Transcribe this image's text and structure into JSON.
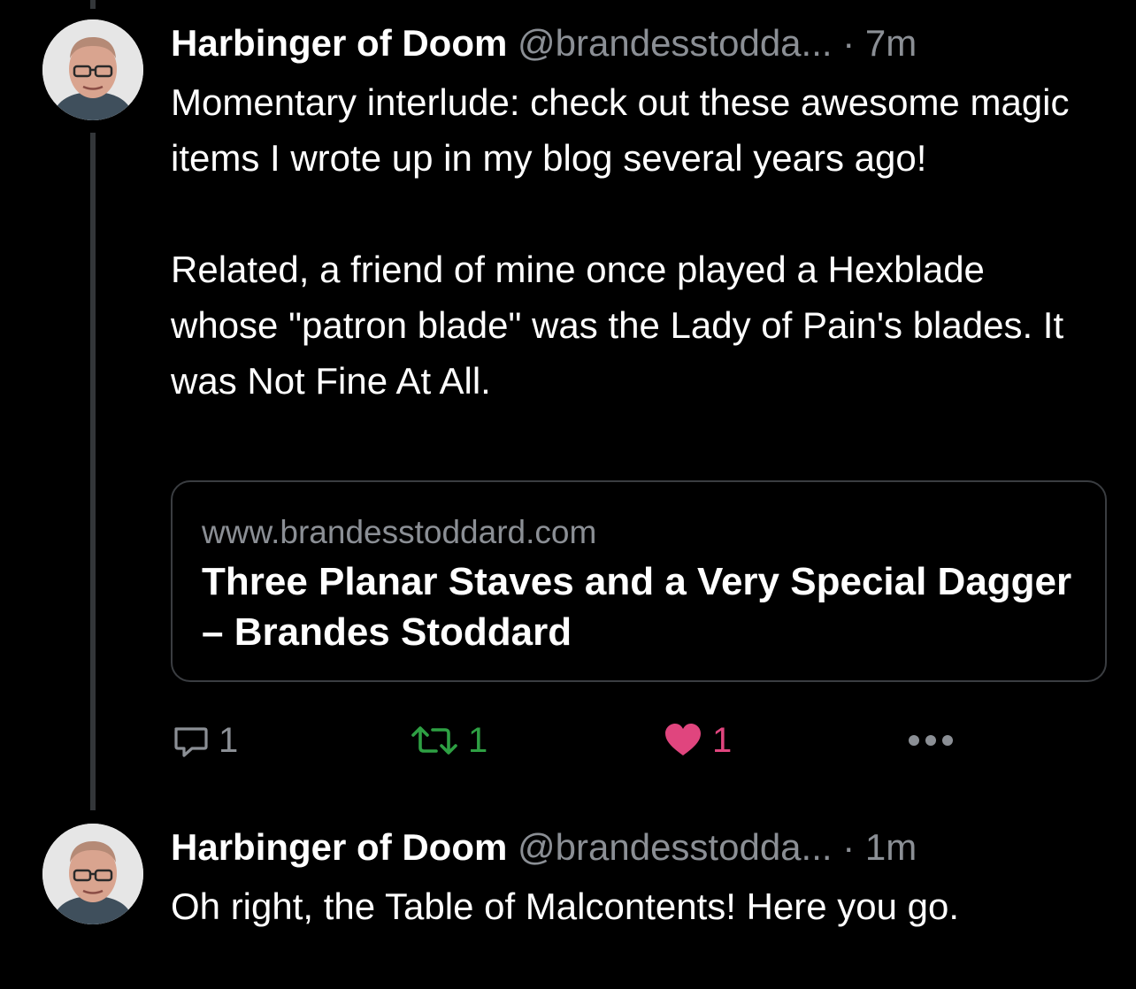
{
  "tweets": [
    {
      "display_name": "Harbinger of Doom",
      "handle": "@brandesstodda...",
      "separator": "·",
      "time": "7m",
      "text_paragraphs": [
        "Momentary interlude: check out these awesome magic items I wrote up in my blog several years ago!",
        "Related, a friend of mine once played a Hexblade whose \"patron blade\" was the Lady of Pain's blades. It was Not Fine At All."
      ],
      "link_card": {
        "domain": "www.brandesstoddard.com",
        "title": "Three Planar Staves and a Very Special Dagger – Brandes Stoddard"
      },
      "actions": {
        "reply_count": "1",
        "retweet_count": "1",
        "like_count": "1",
        "reply_icon": "reply-icon",
        "retweet_icon": "retweet-icon",
        "like_icon": "heart-icon",
        "more_icon": "more-icon"
      }
    },
    {
      "display_name": "Harbinger of Doom",
      "handle": "@brandesstodda...",
      "separator": "·",
      "time": "1m",
      "text_paragraphs": [
        "Oh right, the Table of Malcontents! Here you go."
      ]
    }
  ],
  "colors": {
    "background": "#000000",
    "muted_text": "#8b8f95",
    "retweet_green": "#2ea043",
    "like_pink": "#e0457e",
    "card_border": "#3a3d41"
  }
}
